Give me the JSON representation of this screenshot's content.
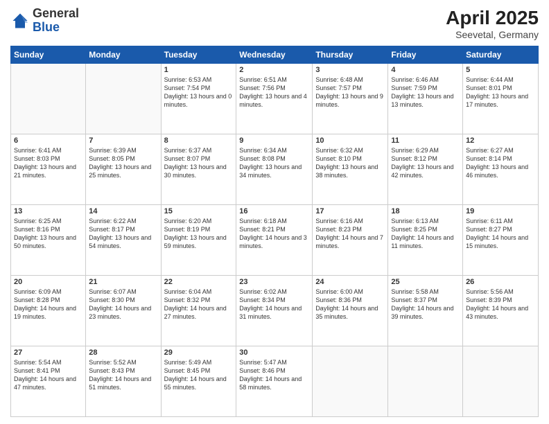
{
  "header": {
    "logo_general": "General",
    "logo_blue": "Blue",
    "month_title": "April 2025",
    "location": "Seevetal, Germany"
  },
  "weekdays": [
    "Sunday",
    "Monday",
    "Tuesday",
    "Wednesday",
    "Thursday",
    "Friday",
    "Saturday"
  ],
  "weeks": [
    [
      {
        "day": "",
        "info": ""
      },
      {
        "day": "",
        "info": ""
      },
      {
        "day": "1",
        "info": "Sunrise: 6:53 AM\nSunset: 7:54 PM\nDaylight: 13 hours and 0 minutes."
      },
      {
        "day": "2",
        "info": "Sunrise: 6:51 AM\nSunset: 7:56 PM\nDaylight: 13 hours and 4 minutes."
      },
      {
        "day": "3",
        "info": "Sunrise: 6:48 AM\nSunset: 7:57 PM\nDaylight: 13 hours and 9 minutes."
      },
      {
        "day": "4",
        "info": "Sunrise: 6:46 AM\nSunset: 7:59 PM\nDaylight: 13 hours and 13 minutes."
      },
      {
        "day": "5",
        "info": "Sunrise: 6:44 AM\nSunset: 8:01 PM\nDaylight: 13 hours and 17 minutes."
      }
    ],
    [
      {
        "day": "6",
        "info": "Sunrise: 6:41 AM\nSunset: 8:03 PM\nDaylight: 13 hours and 21 minutes."
      },
      {
        "day": "7",
        "info": "Sunrise: 6:39 AM\nSunset: 8:05 PM\nDaylight: 13 hours and 25 minutes."
      },
      {
        "day": "8",
        "info": "Sunrise: 6:37 AM\nSunset: 8:07 PM\nDaylight: 13 hours and 30 minutes."
      },
      {
        "day": "9",
        "info": "Sunrise: 6:34 AM\nSunset: 8:08 PM\nDaylight: 13 hours and 34 minutes."
      },
      {
        "day": "10",
        "info": "Sunrise: 6:32 AM\nSunset: 8:10 PM\nDaylight: 13 hours and 38 minutes."
      },
      {
        "day": "11",
        "info": "Sunrise: 6:29 AM\nSunset: 8:12 PM\nDaylight: 13 hours and 42 minutes."
      },
      {
        "day": "12",
        "info": "Sunrise: 6:27 AM\nSunset: 8:14 PM\nDaylight: 13 hours and 46 minutes."
      }
    ],
    [
      {
        "day": "13",
        "info": "Sunrise: 6:25 AM\nSunset: 8:16 PM\nDaylight: 13 hours and 50 minutes."
      },
      {
        "day": "14",
        "info": "Sunrise: 6:22 AM\nSunset: 8:17 PM\nDaylight: 13 hours and 54 minutes."
      },
      {
        "day": "15",
        "info": "Sunrise: 6:20 AM\nSunset: 8:19 PM\nDaylight: 13 hours and 59 minutes."
      },
      {
        "day": "16",
        "info": "Sunrise: 6:18 AM\nSunset: 8:21 PM\nDaylight: 14 hours and 3 minutes."
      },
      {
        "day": "17",
        "info": "Sunrise: 6:16 AM\nSunset: 8:23 PM\nDaylight: 14 hours and 7 minutes."
      },
      {
        "day": "18",
        "info": "Sunrise: 6:13 AM\nSunset: 8:25 PM\nDaylight: 14 hours and 11 minutes."
      },
      {
        "day": "19",
        "info": "Sunrise: 6:11 AM\nSunset: 8:27 PM\nDaylight: 14 hours and 15 minutes."
      }
    ],
    [
      {
        "day": "20",
        "info": "Sunrise: 6:09 AM\nSunset: 8:28 PM\nDaylight: 14 hours and 19 minutes."
      },
      {
        "day": "21",
        "info": "Sunrise: 6:07 AM\nSunset: 8:30 PM\nDaylight: 14 hours and 23 minutes."
      },
      {
        "day": "22",
        "info": "Sunrise: 6:04 AM\nSunset: 8:32 PM\nDaylight: 14 hours and 27 minutes."
      },
      {
        "day": "23",
        "info": "Sunrise: 6:02 AM\nSunset: 8:34 PM\nDaylight: 14 hours and 31 minutes."
      },
      {
        "day": "24",
        "info": "Sunrise: 6:00 AM\nSunset: 8:36 PM\nDaylight: 14 hours and 35 minutes."
      },
      {
        "day": "25",
        "info": "Sunrise: 5:58 AM\nSunset: 8:37 PM\nDaylight: 14 hours and 39 minutes."
      },
      {
        "day": "26",
        "info": "Sunrise: 5:56 AM\nSunset: 8:39 PM\nDaylight: 14 hours and 43 minutes."
      }
    ],
    [
      {
        "day": "27",
        "info": "Sunrise: 5:54 AM\nSunset: 8:41 PM\nDaylight: 14 hours and 47 minutes."
      },
      {
        "day": "28",
        "info": "Sunrise: 5:52 AM\nSunset: 8:43 PM\nDaylight: 14 hours and 51 minutes."
      },
      {
        "day": "29",
        "info": "Sunrise: 5:49 AM\nSunset: 8:45 PM\nDaylight: 14 hours and 55 minutes."
      },
      {
        "day": "30",
        "info": "Sunrise: 5:47 AM\nSunset: 8:46 PM\nDaylight: 14 hours and 58 minutes."
      },
      {
        "day": "",
        "info": ""
      },
      {
        "day": "",
        "info": ""
      },
      {
        "day": "",
        "info": ""
      }
    ]
  ]
}
